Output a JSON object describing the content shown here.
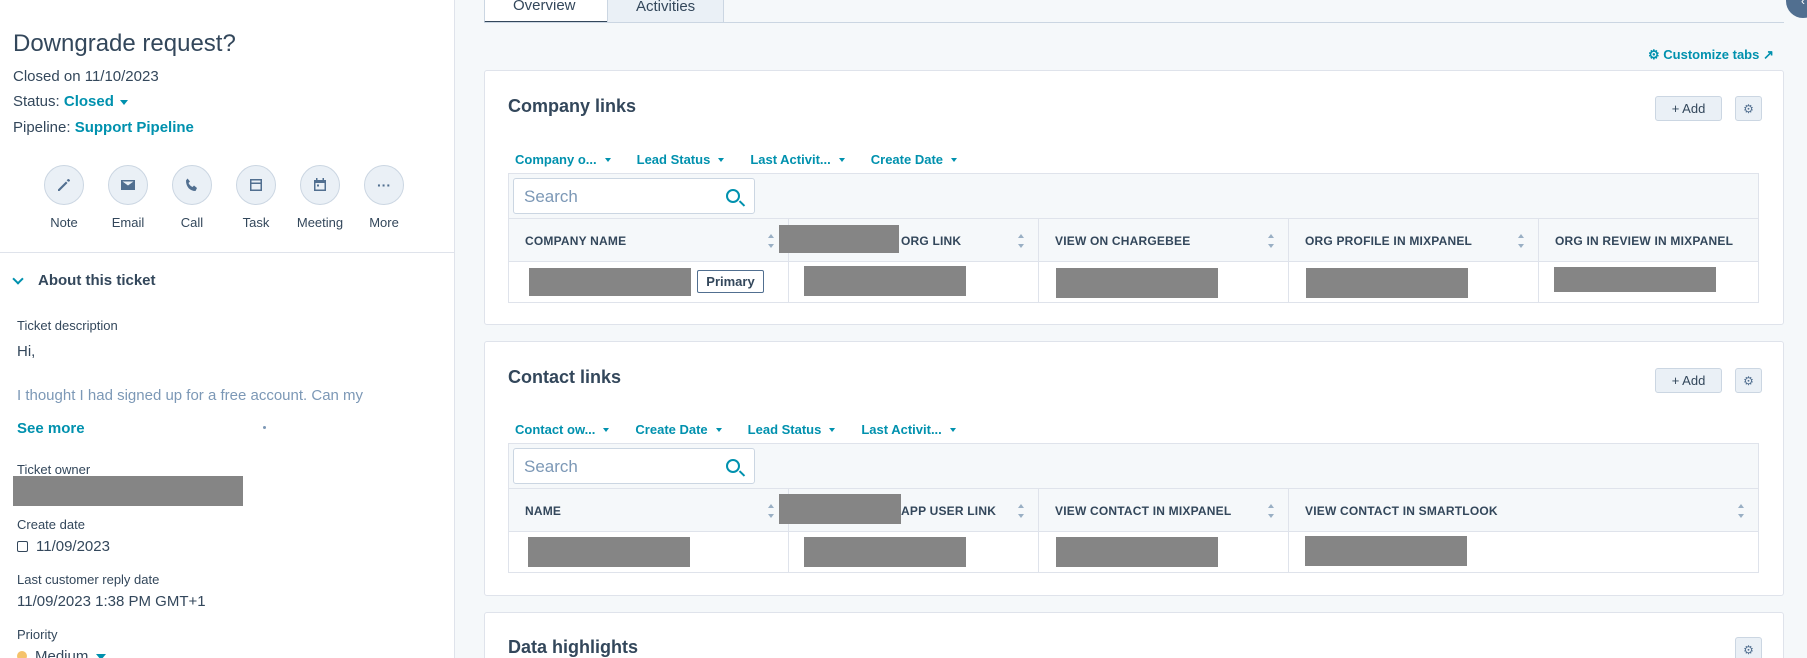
{
  "ticket": {
    "title": "Downgrade request?",
    "closed_on": "Closed on 11/10/2023",
    "status_label": "Status:",
    "status_value": "Closed",
    "pipeline_label": "Pipeline:",
    "pipeline_value": "Support Pipeline"
  },
  "actions": [
    {
      "label": "Note",
      "icon": "pencil-icon"
    },
    {
      "label": "Email",
      "icon": "envelope-icon"
    },
    {
      "label": "Call",
      "icon": "phone-icon"
    },
    {
      "label": "Task",
      "icon": "task-icon"
    },
    {
      "label": "Meeting",
      "icon": "calendar-icon"
    },
    {
      "label": "More",
      "icon": "ellipsis-icon"
    }
  ],
  "about": {
    "header": "About this ticket",
    "desc_label": "Ticket description",
    "desc_line1": "Hi,",
    "desc_line2": "I thought I had signed up for a free account. Can my",
    "see_more": "See more",
    "owner_label": "Ticket owner",
    "create_label": "Create date",
    "create_value": "11/09/2023",
    "reply_label": "Last customer reply date",
    "reply_value": "11/09/2023 1:38 PM GMT+1",
    "priority_label": "Priority",
    "priority_value": "Medium"
  },
  "tabs": {
    "overview": "Overview",
    "activities": "Activities"
  },
  "customize_tabs": "Customize tabs",
  "company_card": {
    "title": "Company links",
    "add": "+ Add",
    "filters": [
      "Company o...",
      "Lead Status",
      "Last Activit...",
      "Create Date"
    ],
    "search_placeholder": "Search",
    "columns": [
      "COMPANY NAME",
      "ORG LINK",
      "VIEW ON CHARGEBEE",
      "ORG PROFILE IN MIXPANEL",
      "ORG IN REVIEW IN MIXPANEL"
    ],
    "primary_tag": "Primary"
  },
  "contact_card": {
    "title": "Contact links",
    "add": "+ Add",
    "filters": [
      "Contact ow...",
      "Create Date",
      "Lead Status",
      "Last Activit..."
    ],
    "search_placeholder": "Search",
    "columns": [
      "NAME",
      "APP USER LINK",
      "VIEW CONTACT IN MIXPANEL",
      "VIEW CONTACT IN SMARTLOOK"
    ]
  },
  "data_card": {
    "title": "Data highlights"
  },
  "colors": {
    "accent": "#0091ae",
    "text": "#33475b",
    "redaction": "#858585"
  }
}
